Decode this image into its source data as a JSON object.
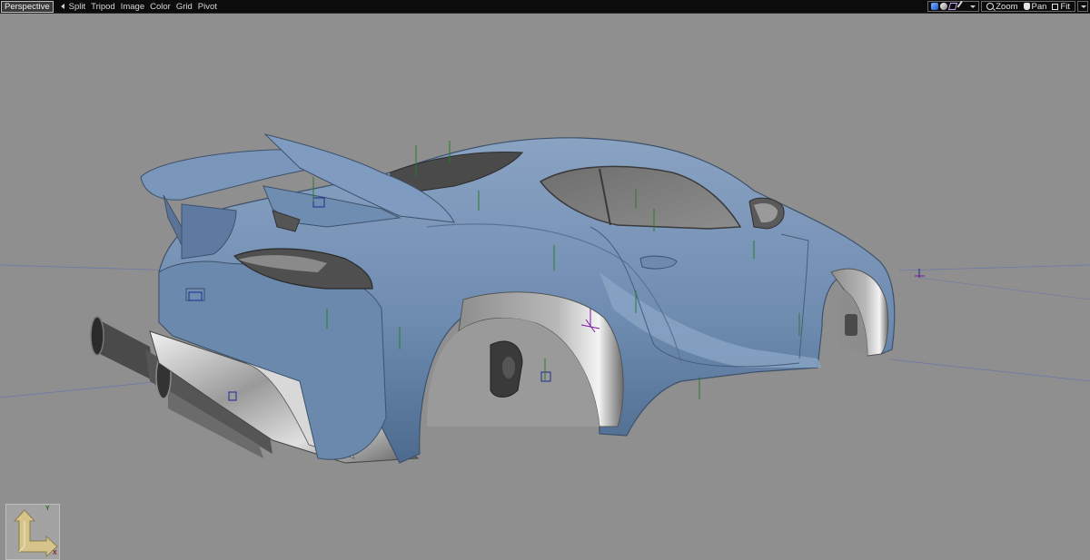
{
  "toolbar": {
    "view_name": "Perspective",
    "menu": [
      "Split",
      "Tripod",
      "Image",
      "Color",
      "Grid",
      "Pivot"
    ],
    "nav": {
      "zoom": "Zoom",
      "pan": "Pan",
      "fit": "Fit"
    }
  },
  "gizmo": {
    "x_label": "X",
    "y_label": "Y"
  },
  "colors": {
    "viewport_bg": "#8f8f8f",
    "body_paint": "#6f8cb1",
    "toolbar_bg": "#0c0c0c"
  },
  "icons": [
    "shaded-mode-icon",
    "smooth-shade-icon",
    "wireframe-icon",
    "pen-icon",
    "zoom-icon",
    "pan-hand-icon",
    "fit-icon",
    "dropdown-arrow-icon"
  ]
}
